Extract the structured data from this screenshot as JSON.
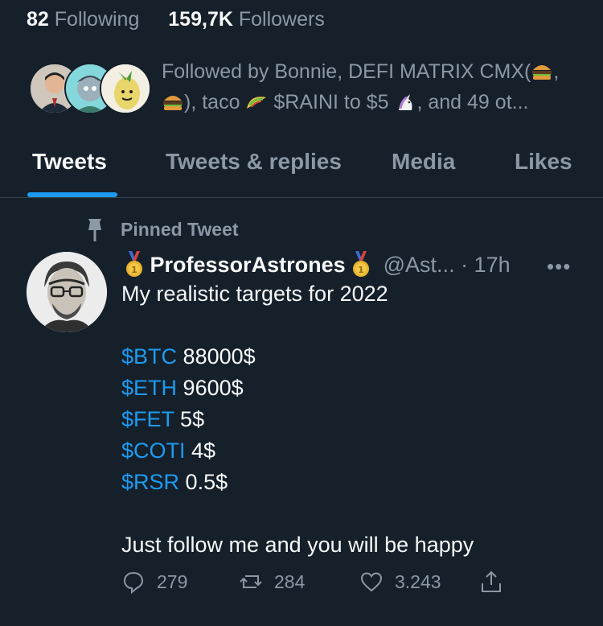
{
  "profile": {
    "following_count": "82",
    "following_label": "Following",
    "followers_count": "159,7K",
    "followers_label": "Followers",
    "followed_by": {
      "line1_text": "Followed by Bonnie, DEFI MATRIX CMX(",
      "line1_tail": ",",
      "line2_a": "), taco",
      "line2_b": "$RAINI to $5",
      "line2_c": ", and 49 ot..."
    }
  },
  "tabs": [
    {
      "label": "Tweets",
      "active": true
    },
    {
      "label": "Tweets & replies",
      "active": false
    },
    {
      "label": "Media",
      "active": false
    },
    {
      "label": "Likes",
      "active": false
    }
  ],
  "tweet": {
    "pinned_label": "Pinned Tweet",
    "author_name": "ProfessorAstrones",
    "handle_time": "@Ast... · 17h",
    "more": "•••",
    "intro": "My realistic targets for 2022",
    "targets": [
      {
        "ticker": "$BTC",
        "value": "88000$"
      },
      {
        "ticker": "$ETH",
        "value": "9600$"
      },
      {
        "ticker": "$FET",
        "value": "5$"
      },
      {
        "ticker": "$COTI",
        "value": "4$"
      },
      {
        "ticker": "$RSR",
        "value": "0.5$"
      }
    ],
    "closing": "Just follow me and you will be happy",
    "replies": "279",
    "retweets": "284",
    "likes": "3.243"
  },
  "colors": {
    "background": "#15202b",
    "accent": "#1d9bf0",
    "muted": "#8b98a5"
  }
}
